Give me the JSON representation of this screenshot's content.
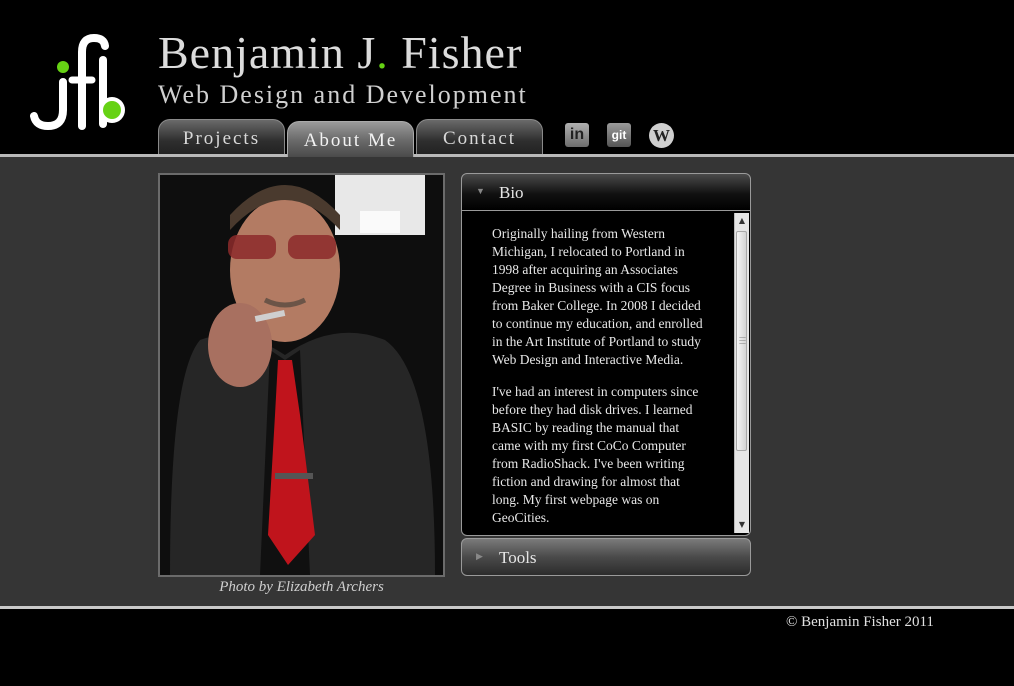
{
  "header": {
    "name_before_dot": "Benjamin J",
    "name_dot": ".",
    "name_after_dot": " Fisher",
    "subtitle": "Web Design and Development"
  },
  "nav": {
    "tabs": [
      {
        "label": "Projects",
        "active": false
      },
      {
        "label": "About Me",
        "active": true
      },
      {
        "label": "Contact",
        "active": false
      }
    ]
  },
  "social": {
    "linkedin_glyph": "in",
    "git_glyph": "git",
    "wordpress_glyph": "W"
  },
  "photo": {
    "caption": "Photo by Elizabeth Archers"
  },
  "accordion": {
    "bio": {
      "label": "Bio",
      "paragraphs": [
        "Originally hailing from Western Michigan, I relocated to Portland in 1998 after acquiring an Associates Degree in Business with a CIS focus from Baker College. In 2008 I decided to continue my education, and enrolled in the Art Institute of Portland to study Web Design and Interactive Media.",
        "I've had an interest in computers since before they had disk drives. I learned BASIC by reading the manual that came with my first CoCo Computer from RadioShack. I've been writing fiction and drawing for almost that long. My first webpage was on GeoCities."
      ]
    },
    "tools": {
      "label": "Tools"
    }
  },
  "footer": {
    "copyright": "© Benjamin Fisher 2011"
  },
  "colors": {
    "accent_green": "#66d214",
    "page_background": "#000000",
    "content_background": "#353535"
  }
}
